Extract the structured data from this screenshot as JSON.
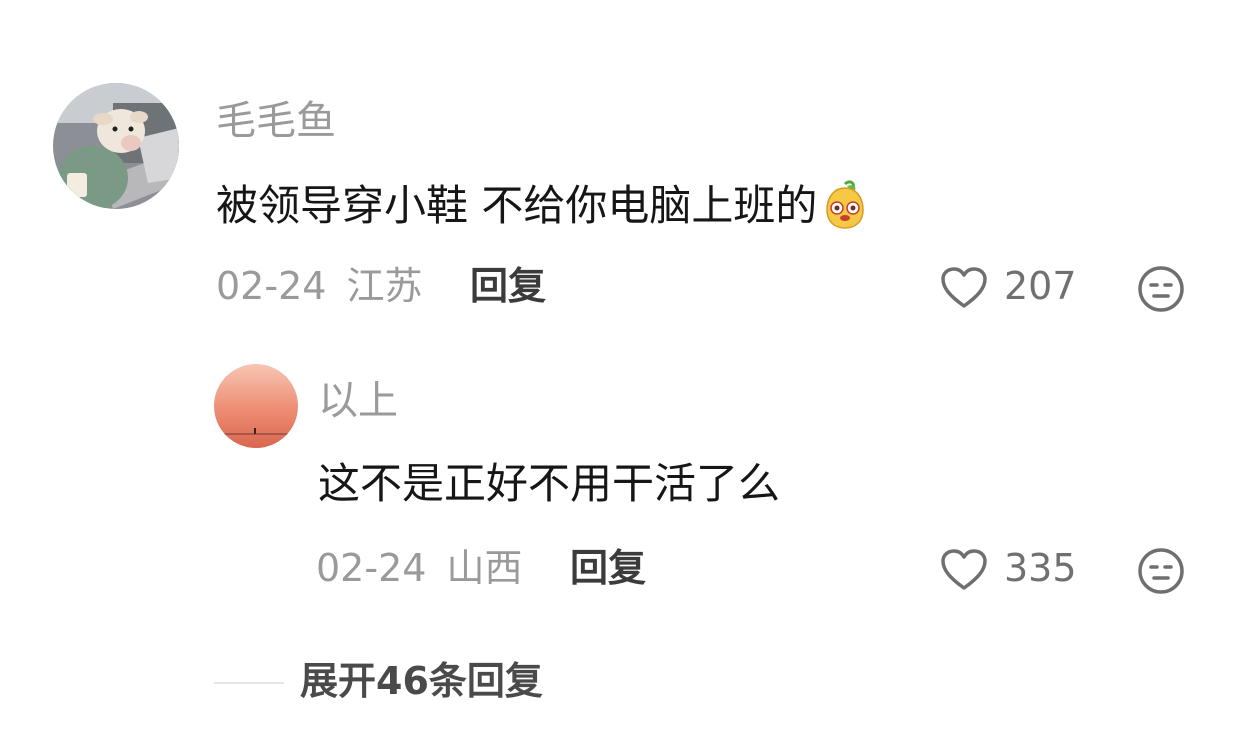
{
  "comment": {
    "username": "毛毛鱼",
    "text": "被领导穿小鞋 不给你电脑上班的",
    "emoji_icon": "smiling-face-emoji",
    "date": "02-24",
    "location": "江苏",
    "reply_label": "回复",
    "likes": "207",
    "like_icon": "heart-outline-icon",
    "dislike_icon": "expressionless-face-icon"
  },
  "reply": {
    "username": "以上",
    "text": "这不是正好不用干活了么",
    "date": "02-24",
    "location": "山西",
    "reply_label": "回复",
    "likes": "335",
    "like_icon": "heart-outline-icon",
    "dislike_icon": "expressionless-face-icon"
  },
  "expand_replies_label": "展开46条回复",
  "colors": {
    "username": "#9a9a9a",
    "text": "#161616",
    "meta": "#9a9a9a",
    "accent_reply": "#3b3b3b"
  }
}
